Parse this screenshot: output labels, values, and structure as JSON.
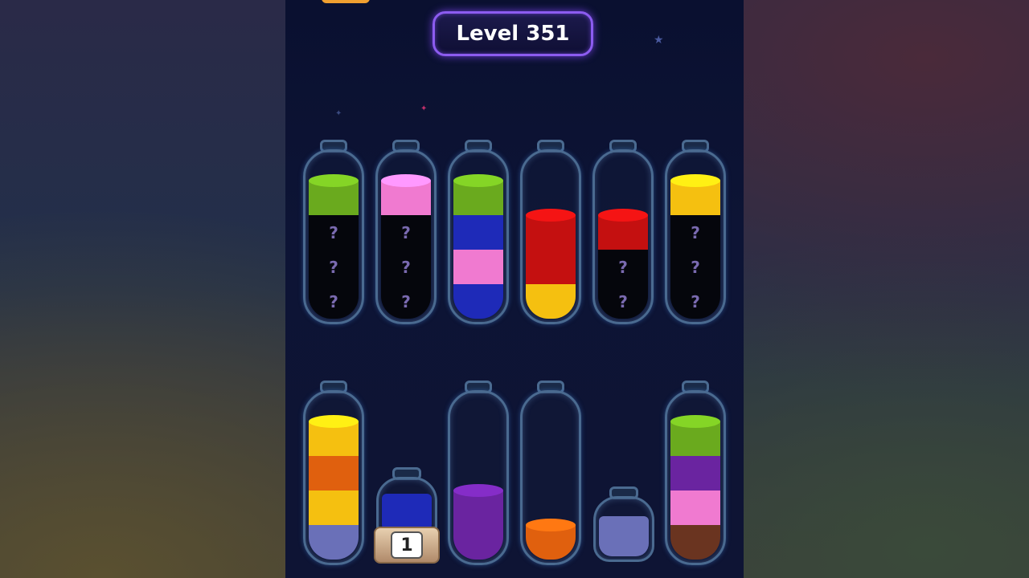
{
  "level": {
    "label": "Level 351"
  },
  "hidden_mark": "?",
  "colors": {
    "green": "#6aaa1e",
    "pink": "#f07ad0",
    "blue": "#1e2ab8",
    "red": "#c41010",
    "yellow": "#f5c010",
    "orange": "#e0600e",
    "lavender": "#6a70b8",
    "purple": "#6a24a0",
    "brown": "#6a3420",
    "hidden": "#05060c"
  },
  "tubes_row1": [
    {
      "id": "tube-1",
      "layers": [
        "green",
        "hidden",
        "hidden",
        "hidden"
      ]
    },
    {
      "id": "tube-2",
      "layers": [
        "pink",
        "hidden",
        "hidden",
        "hidden"
      ]
    },
    {
      "id": "tube-3",
      "layers": [
        "green",
        "blue",
        "pink",
        "blue"
      ]
    },
    {
      "id": "tube-4",
      "layers": [
        "red",
        "red",
        "yellow"
      ]
    },
    {
      "id": "tube-5",
      "layers": [
        "red",
        "hidden",
        "hidden"
      ]
    },
    {
      "id": "tube-6",
      "layers": [
        "yellow",
        "hidden",
        "hidden",
        "hidden"
      ]
    }
  ],
  "tubes_row2": [
    {
      "id": "tube-7",
      "layers": [
        "yellow",
        "orange",
        "yellow",
        "lavender"
      ]
    },
    {
      "id": "tube-9",
      "layers": [
        "purple",
        "purple"
      ]
    },
    {
      "id": "tube-10",
      "layers": [
        "orange"
      ]
    },
    {
      "id": "tube-12",
      "layers": [
        "green",
        "purple",
        "pink",
        "brown"
      ]
    }
  ],
  "small_bottle_blue": {
    "color": "blue",
    "stand_count": "1"
  },
  "small_bottle_lavender": {
    "color": "lavender"
  }
}
